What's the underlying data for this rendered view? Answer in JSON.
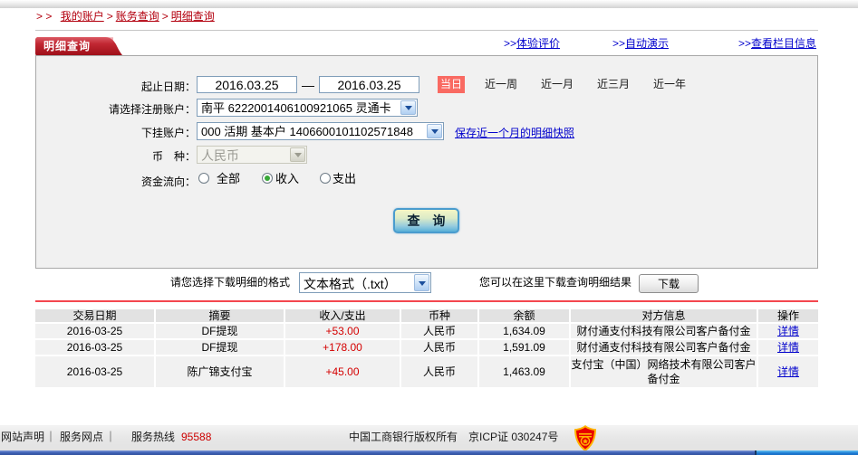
{
  "breadcrumb": {
    "prefix": "> >",
    "separator": ">",
    "items": [
      "我的账户",
      "账务查询",
      "明细查询"
    ]
  },
  "tab": {
    "label": "明细查询"
  },
  "top_links": {
    "prefix": ">>",
    "experience": "体验评价",
    "demo": "自动演示",
    "column_info": "查看栏目信息"
  },
  "form": {
    "date_label": "起止日期：",
    "date_from": "2016.03.25",
    "date_dash": "—",
    "date_to": "2016.03.25",
    "today_button": "当日",
    "quick_ranges": {
      "week": "近一周",
      "month": "近一月",
      "quarter": "近三月",
      "year": "近一年"
    },
    "account_label": "请选择注册账户：",
    "account_value": "南平  6222001406100921065 灵通卡",
    "sub_account_label": "下挂账户：",
    "sub_account_value": "000 活期 基本户 1406600101102571848",
    "save_snapshot_link": "保存近一个月的明细快照",
    "currency_label": "币　种：",
    "currency_value": "人民币",
    "flow_label": "资金流向：",
    "flow_options": {
      "all": {
        "label": "全部",
        "selected": false
      },
      "income": {
        "label": "收入",
        "selected": true
      },
      "expense": {
        "label": "支出",
        "selected": false
      }
    },
    "query_button": "查 询"
  },
  "download": {
    "format_label": "请您选择下载明细的格式",
    "format_value": "文本格式（.txt）",
    "hint": "您可以在这里下载查询明细结果",
    "button": "下载"
  },
  "table": {
    "headers": [
      "交易日期",
      "摘要",
      "收入/支出",
      "币种",
      "余额",
      "对方信息",
      "操作"
    ],
    "detail_label": "详情",
    "rows": [
      {
        "date": "2016-03-25",
        "summary": "DF提现",
        "amount": "+53.00",
        "currency": "人民币",
        "balance": "1,634.09",
        "counterparty": "财付通支付科技有限公司客户备付金",
        "action": "详情"
      },
      {
        "date": "2016-03-25",
        "summary": "DF提现",
        "amount": "+178.00",
        "currency": "人民币",
        "balance": "1,591.09",
        "counterparty": "财付通支付科技有限公司客户备付金",
        "action": "详情"
      },
      {
        "date": "2016-03-25",
        "summary": "陈广锦支付宝",
        "amount": "+45.00",
        "currency": "人民币",
        "balance": "1,463.09",
        "counterparty": "支付宝（中国）网络技术有限公司客户备付金",
        "action": "详情"
      }
    ]
  },
  "footer": {
    "statement": "网站声明",
    "separator": "｜",
    "outlets": "服务网点",
    "hotline_label": "服务热线",
    "hotline_number": "95588",
    "copyright": "中国工商银行版权所有　京ICP证 030247号"
  },
  "colors": {
    "brand_red": "#b3000e",
    "tab_red_top": "#d9545e",
    "tab_red_bottom": "#9c0d17",
    "link_blue": "#0000cc",
    "amount_red": "#d40000",
    "today_salmon": "#f96a62",
    "divider_red": "#f4474f",
    "panel_gray": "#f1f1f1",
    "header_gray": "#e2e2e2"
  }
}
